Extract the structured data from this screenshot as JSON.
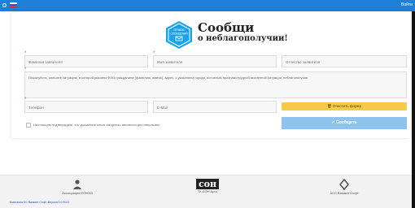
{
  "topbar": {
    "right_text": "Войти"
  },
  "logo": {
    "badge_l1": "ПРИЕМ",
    "badge_l2": "СООБЩЕНИЙ",
    "title": "Сообщи",
    "subtitle": "о неблагополучии!"
  },
  "form": {
    "last_name": "Фамилия заявителя",
    "first_name": "Имя заявителя",
    "patronymic": "Отчество заявителя",
    "description": "Пожалуйста, опишите ситуацию, в которой указаны ФИО гражданина (фамилию, имена), адрес, с указанием города, основным признаки трудной жизненной ситуации, неблагополучия",
    "phone": "Телефон",
    "email": "E-Mail",
    "clear_label": "Очистить форму",
    "consent": "Настоящим подтверждаю, что указанные мною сведения, являются достоверными",
    "send_label": "Сообщить"
  },
  "footer": {
    "item1": "Ассоциация СОНКО",
    "item2": "ТК СОН Арго",
    "item2_logo": "сон",
    "item3": "АСС Ваммат Софт",
    "copyright": "Компания ЧС Ваммат Софт. Версия 1.0 2021"
  },
  "colors": {
    "accent": "#1e7fd8",
    "yellow": "#f7c948",
    "send": "#8fc3ee",
    "hex": "#1aa3e8"
  }
}
